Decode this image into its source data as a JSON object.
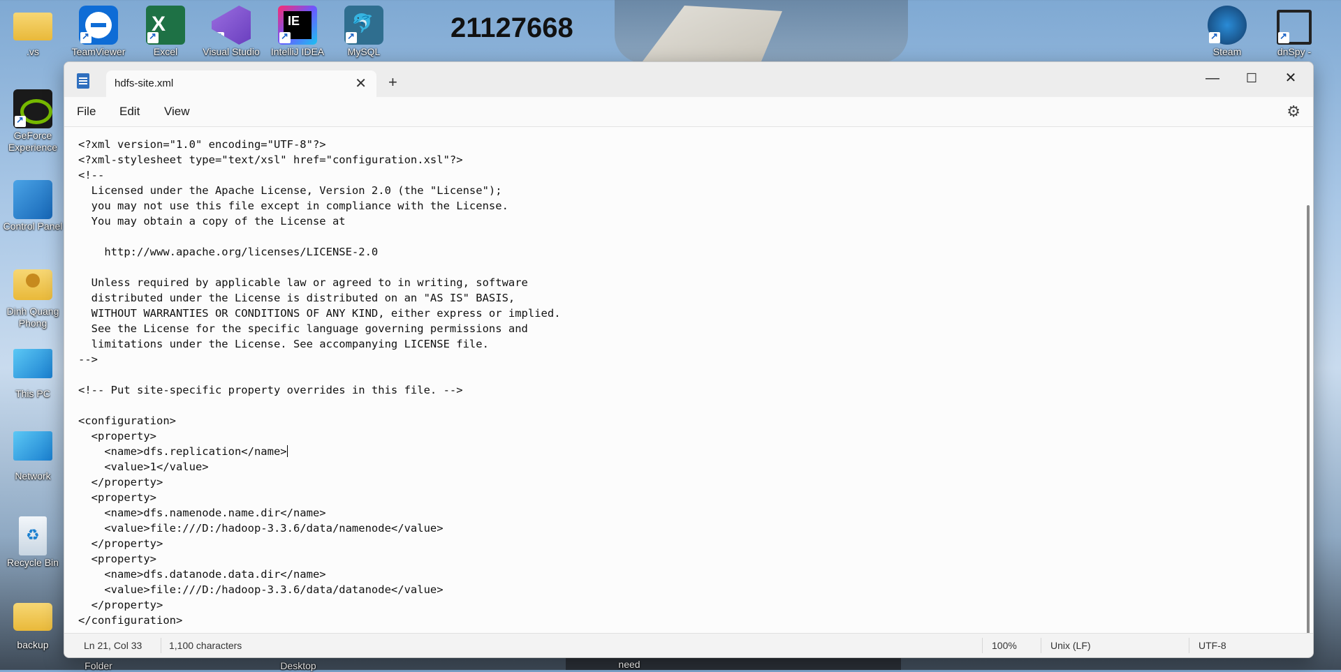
{
  "desktop": {
    "number": "21127668",
    "icons": [
      {
        "label": ".vs",
        "icon": "folder-icon"
      },
      {
        "label": "TeamViewer",
        "icon": "teamviewer-icon"
      },
      {
        "label": "Excel",
        "icon": "excel-icon"
      },
      {
        "label": "Visual Studio",
        "icon": "visual-studio-icon"
      },
      {
        "label": "IntelliJ IDEA",
        "icon": "intellij-icon"
      },
      {
        "label": "MySQL",
        "icon": "mysql-icon"
      },
      {
        "label": "GeForce Experience",
        "icon": "geforce-icon"
      },
      {
        "label": "Control Panel",
        "icon": "control-panel-icon"
      },
      {
        "label": "Dinh Quang Phong",
        "icon": "user-folder-icon"
      },
      {
        "label": "This PC",
        "icon": "monitor-icon"
      },
      {
        "label": "Network",
        "icon": "network-icon"
      },
      {
        "label": "Recycle Bin",
        "icon": "recycle-bin-icon"
      },
      {
        "label": "backup",
        "icon": "folder-icon"
      },
      {
        "label": "Steam",
        "icon": "steam-icon"
      },
      {
        "label": "dnSpy -",
        "icon": "dnspy-icon"
      }
    ],
    "bottom_labels": [
      "Folder",
      "Desktop",
      "need"
    ]
  },
  "window": {
    "tab_title": "hdfs-site.xml",
    "new_tab": "+",
    "minimize": "—",
    "maximize": "☐",
    "close": "✕"
  },
  "menu": {
    "file": "File",
    "edit": "Edit",
    "view": "View"
  },
  "editor": {
    "before_caret": "<?xml version=\"1.0\" encoding=\"UTF-8\"?>\n<?xml-stylesheet type=\"text/xsl\" href=\"configuration.xsl\"?>\n<!--\n  Licensed under the Apache License, Version 2.0 (the \"License\");\n  you may not use this file except in compliance with the License.\n  You may obtain a copy of the License at\n\n    http://www.apache.org/licenses/LICENSE-2.0\n\n  Unless required by applicable law or agreed to in writing, software\n  distributed under the License is distributed on an \"AS IS\" BASIS,\n  WITHOUT WARRANTIES OR CONDITIONS OF ANY KIND, either express or implied.\n  See the License for the specific language governing permissions and\n  limitations under the License. See accompanying LICENSE file.\n-->\n\n<!-- Put site-specific property overrides in this file. -->\n\n<configuration>\n  <property>\n    <name>dfs.replication</name>",
    "after_caret": "\n    <value>1</value>\n  </property>\n  <property>\n    <name>dfs.namenode.name.dir</name>\n    <value>file:///D:/hadoop-3.3.6/data/namenode</value>\n  </property>\n  <property>\n    <name>dfs.datanode.data.dir</name>\n    <value>file:///D:/hadoop-3.3.6/data/datanode</value>\n  </property>\n</configuration>"
  },
  "status": {
    "position": "Ln 21, Col 33",
    "characters": "1,100 characters",
    "zoom": "100%",
    "line_ending": "Unix (LF)",
    "encoding": "UTF-8"
  }
}
